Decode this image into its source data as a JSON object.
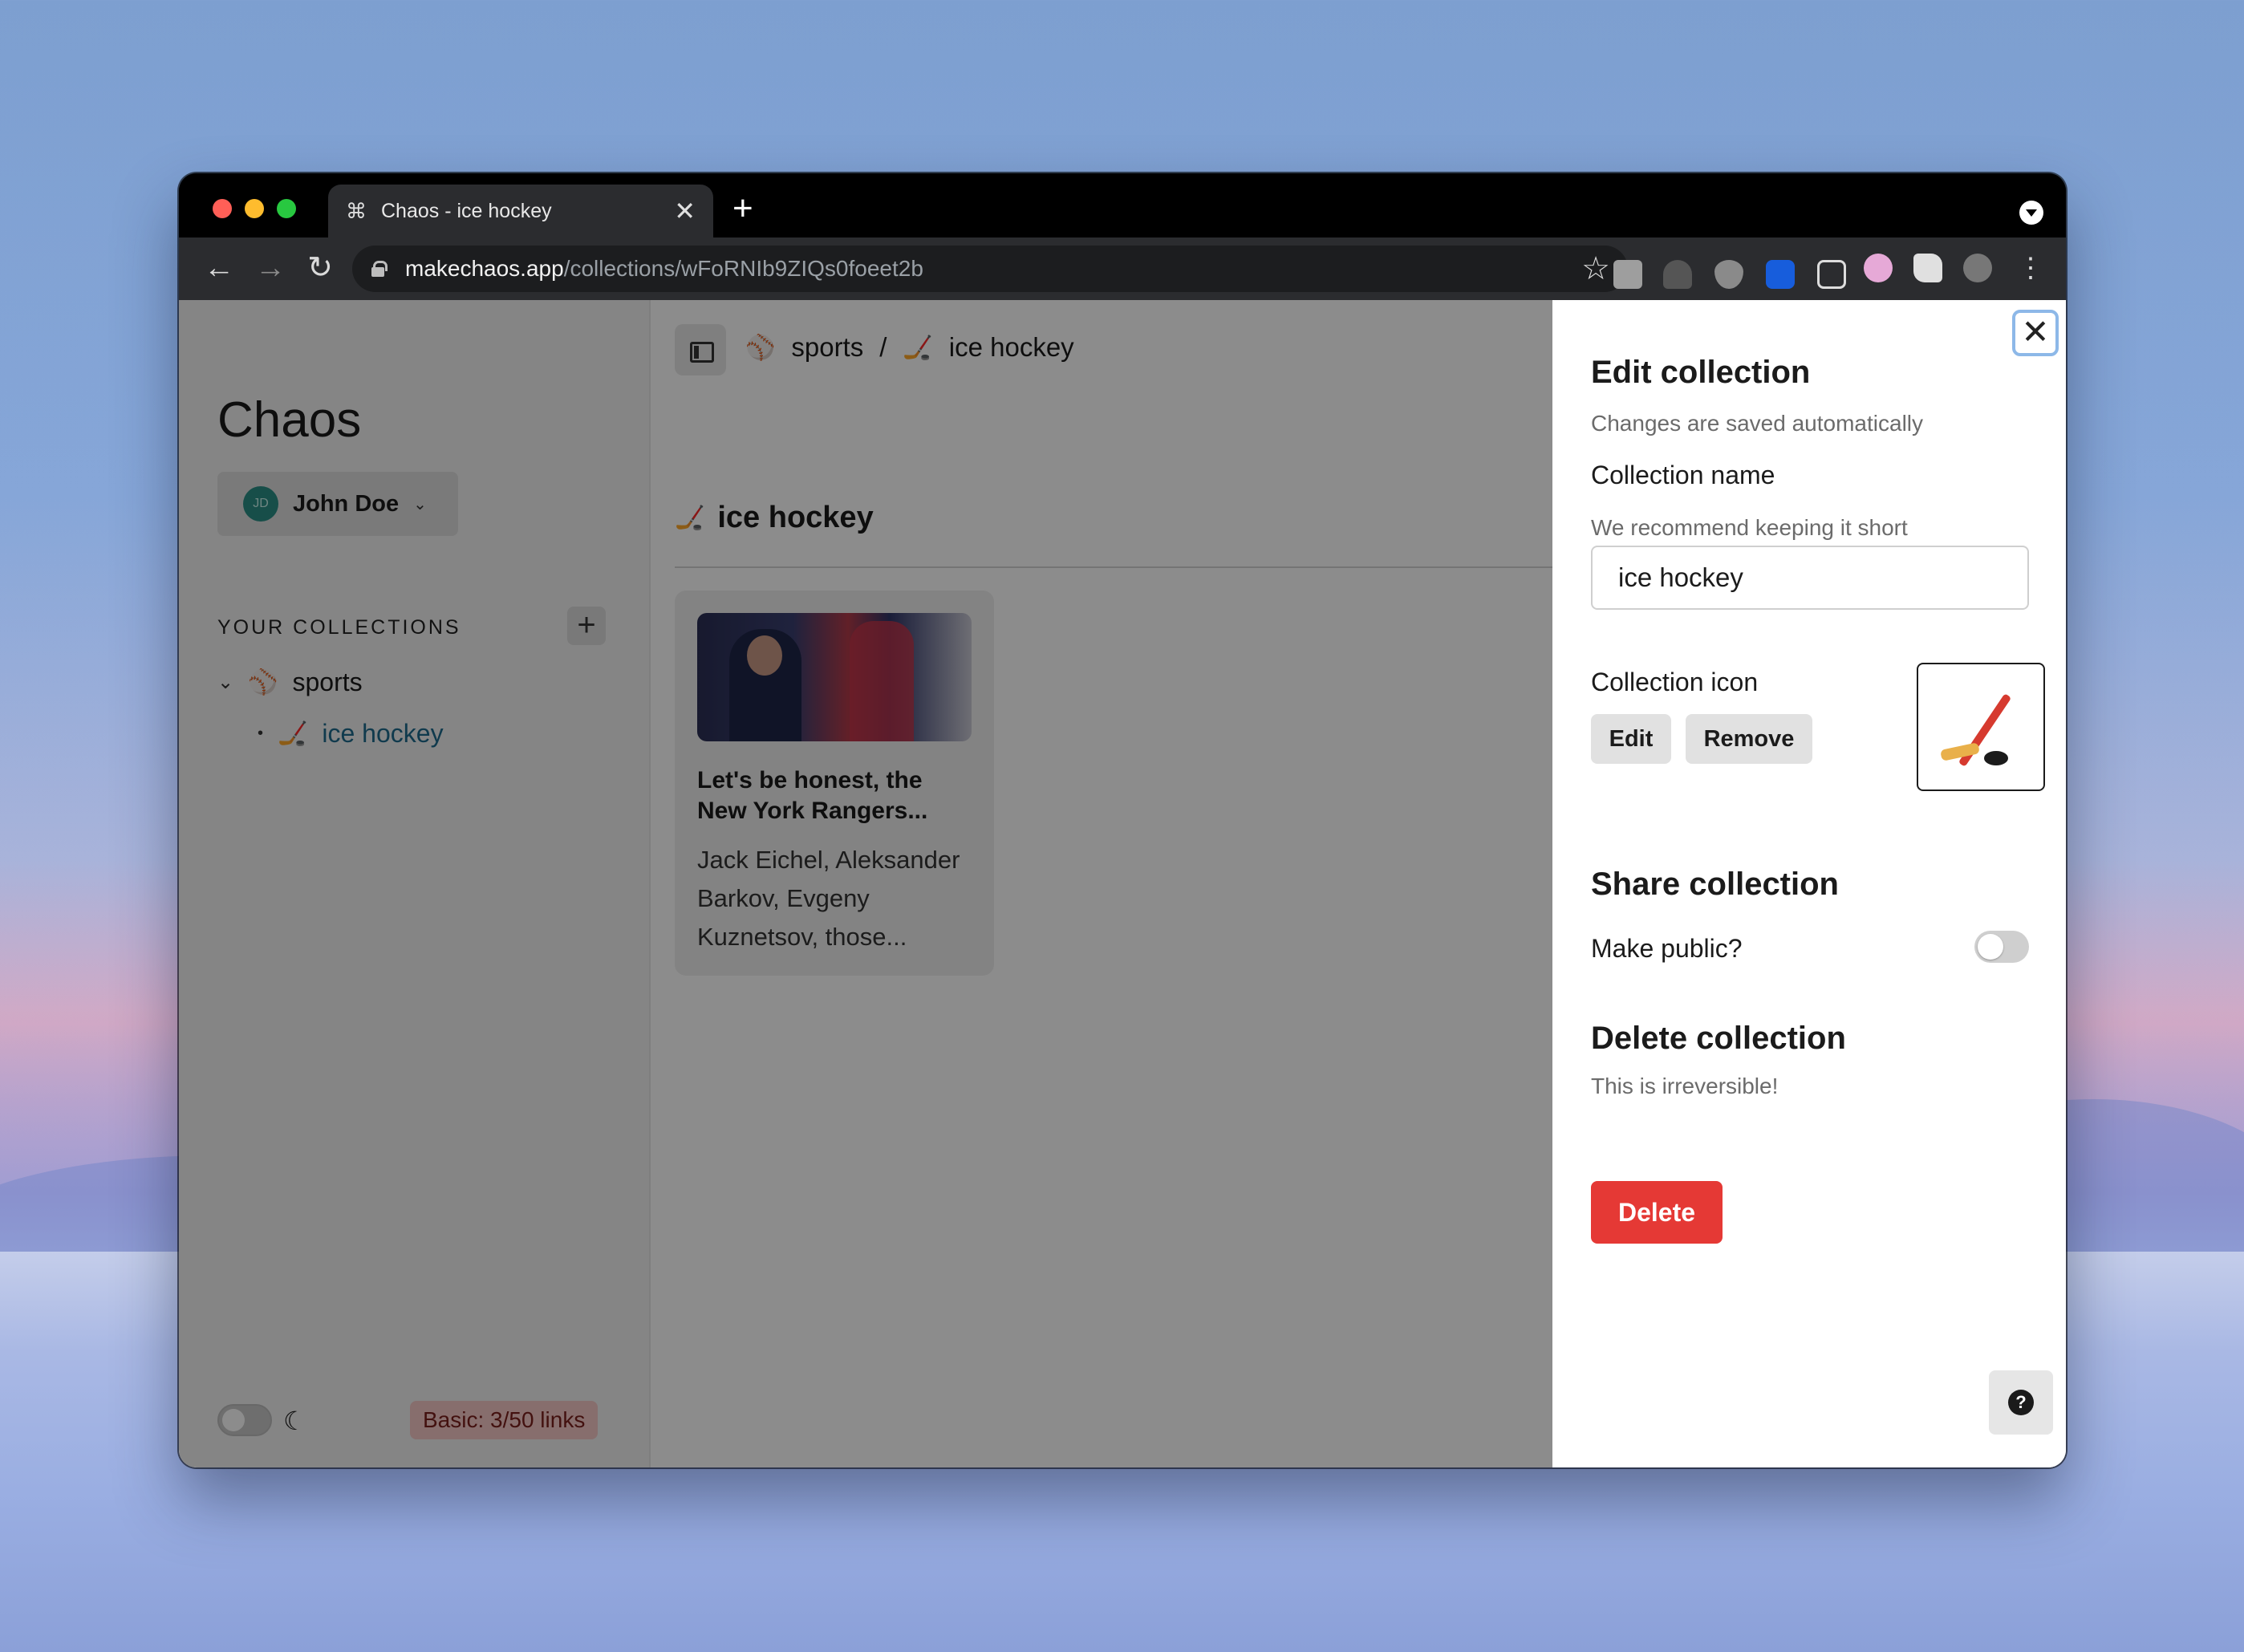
{
  "browser": {
    "tab_title": "Chaos - ice hockey",
    "tab_close": "✕",
    "new_tab": "+",
    "url_host": "makechaos.app",
    "url_path": "/collections/wFoRNIb9ZIQs0foeet2b",
    "icons": [
      "back-icon",
      "forward-icon",
      "reload-icon",
      "lock-icon",
      "star-icon",
      "camera-extension-icon",
      "rocket-extension-icon",
      "ublock-extension-icon",
      "bitwarden-extension-icon",
      "chaos-extension-icon",
      "play-extension-icon",
      "puzzle-extension-icon",
      "profile-avatar-icon",
      "menu-kebab-icon"
    ]
  },
  "sidebar": {
    "app_title": "Chaos",
    "user": {
      "initials": "JD",
      "name": "John Doe"
    },
    "collections_heading": "YOUR COLLECTIONS",
    "add_label": "+",
    "collections": [
      {
        "label": "sports",
        "emoji": "⚾"
      },
      {
        "label": "ice hockey",
        "emoji": "🏒"
      }
    ],
    "plan_badge": "Basic: 3/50 links"
  },
  "main": {
    "breadcrumb": {
      "parent": "sports",
      "separator": "/",
      "current": "ice hockey",
      "parent_emoji": "⚾",
      "current_emoji": "🏒"
    },
    "collection_title": "ice hockey",
    "collection_emoji": "🏒",
    "card": {
      "title": "Let's be honest, the New York Rangers...",
      "description": "Jack Eichel, Aleksander Barkov, Evgeny Kuznetsov, those..."
    }
  },
  "panel": {
    "close_label": "✕",
    "title": "Edit collection",
    "subtitle": "Changes are saved automatically",
    "name_label": "Collection name",
    "name_hint": "We recommend keeping it short",
    "name_value": "ice hockey",
    "icon_label": "Collection icon",
    "edit_button": "Edit",
    "remove_button": "Remove",
    "share_heading": "Share collection",
    "public_label": "Make public?",
    "public_enabled": false,
    "delete_heading": "Delete collection",
    "delete_warning": "This is irreversible!",
    "delete_button": "Delete",
    "help_label": "?"
  },
  "colors": {
    "accent_link": "#1e6b8c",
    "delete_red": "#e53935",
    "plan_badge_bg": "#f6c9c7",
    "avatar_teal": "#2a8f86"
  }
}
